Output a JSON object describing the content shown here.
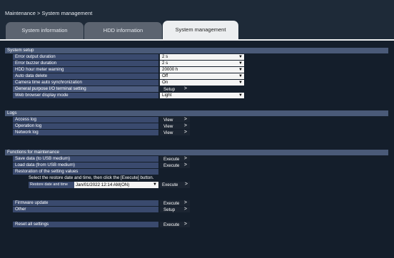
{
  "breadcrumb": "Maintenance > System management",
  "tabs": [
    {
      "label": "System information",
      "active": false
    },
    {
      "label": "HDD information",
      "active": false
    },
    {
      "label": "System management",
      "active": true
    }
  ],
  "system_setup": {
    "heading": "System setup",
    "rows": [
      {
        "label": "Error output duration",
        "value": "2 s"
      },
      {
        "label": "Error buzzer duration",
        "value": "2 s"
      },
      {
        "label": "HDD hour meter warning",
        "value": "20000 h"
      },
      {
        "label": "Auto data delete",
        "value": "Off"
      },
      {
        "label": "Camera time auto synchronization",
        "value": "On"
      },
      {
        "label": "General purpose I/O terminal setting",
        "button": "Setup"
      },
      {
        "label": "Web browser display mode",
        "value": "Light"
      }
    ]
  },
  "logs": {
    "heading": "Logs",
    "rows": [
      {
        "label": "Access log",
        "button": "View"
      },
      {
        "label": "Operation log",
        "button": "View"
      },
      {
        "label": "Network log",
        "button": "View"
      }
    ]
  },
  "maintenance": {
    "heading": "Functions for maintenance",
    "save_label": "Save data (to USB medium)",
    "save_button": "Execute",
    "load_label": "Load data (from USB medium)",
    "load_button": "Execute",
    "restore_label": "Restoration of the setting values",
    "restore_note": "Select the restore date and time, then click the [Execute] button.",
    "restore_field_label": "Restore date and time",
    "restore_value": "Jan/01/2022 12:14 AM(ON)",
    "restore_button": "Execute",
    "firmware_label": "Firmware update",
    "firmware_button": "Execute",
    "other_label": "Other",
    "other_button": "Setup",
    "reset_label": "Reset all settings",
    "reset_button": "Execute"
  },
  "icons": {
    "dropdown": "chevron-down-icon",
    "button_arrow": "chevron-right-icon"
  },
  "colors": {
    "background": "#2a3746",
    "panel": "#141e2b",
    "section_header": "#4a5a78",
    "row_label": "#3a4a6e",
    "active_tab": "#eceef0",
    "inactive_tab": "#5c6470"
  }
}
